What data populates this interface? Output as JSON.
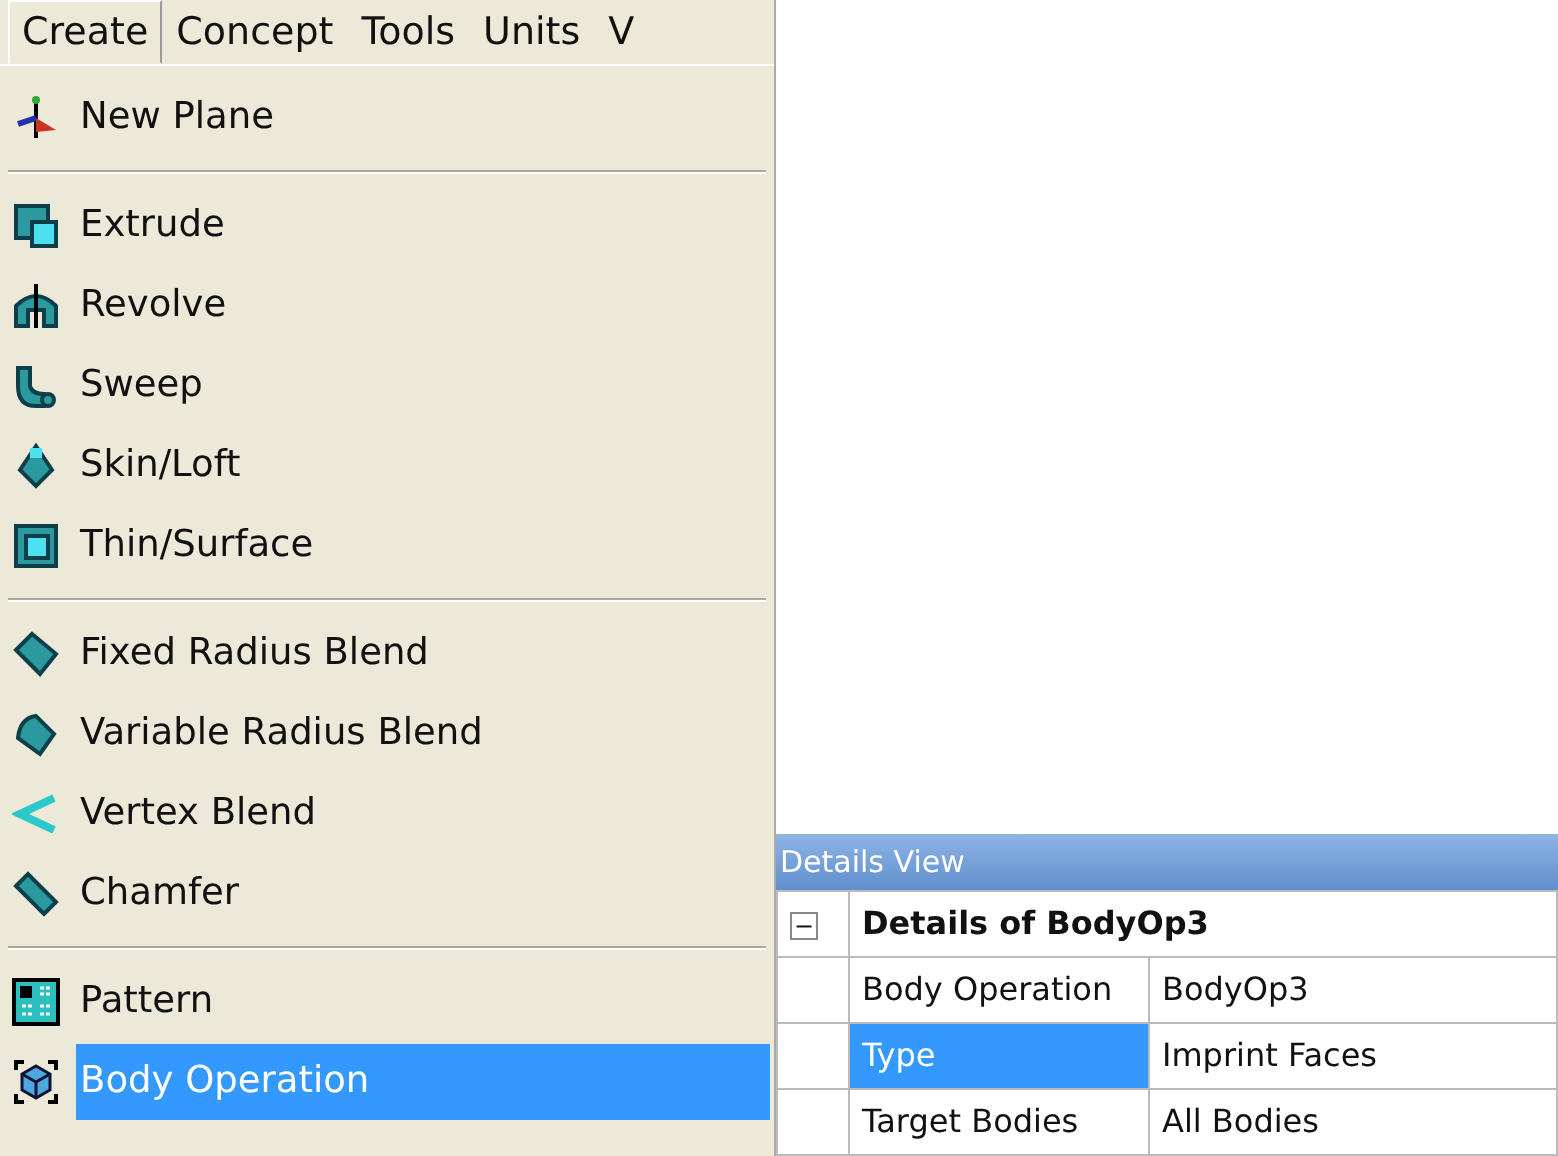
{
  "menu_bar": [
    {
      "label": "Create",
      "selected": true
    },
    {
      "label": "Concept",
      "selected": false
    },
    {
      "label": "Tools",
      "selected": false
    },
    {
      "label": "Units",
      "selected": false
    },
    {
      "label": "V",
      "selected": false
    }
  ],
  "menu_groups": [
    [
      {
        "label": "New Plane",
        "selected": false
      }
    ],
    [
      {
        "label": "Extrude",
        "selected": false
      },
      {
        "label": "Revolve",
        "selected": false
      },
      {
        "label": "Sweep",
        "selected": false
      },
      {
        "label": "Skin/Loft",
        "selected": false
      },
      {
        "label": "Thin/Surface",
        "selected": false
      }
    ],
    [
      {
        "label": "Fixed Radius Blend",
        "selected": false
      },
      {
        "label": "Variable Radius Blend",
        "selected": false
      },
      {
        "label": "Vertex Blend",
        "selected": false
      },
      {
        "label": "Chamfer",
        "selected": false
      }
    ],
    [
      {
        "label": "Pattern",
        "selected": false
      },
      {
        "label": "Body Operation",
        "selected": true
      }
    ]
  ],
  "details_view": {
    "title": "Details View",
    "group": {
      "label": "Details of BodyOp3",
      "expanded": true,
      "toggle": "−"
    },
    "rows": [
      {
        "name": "Body Operation",
        "value": "BodyOp3",
        "selected": false
      },
      {
        "name": "Type",
        "value": "Imprint Faces",
        "selected": true
      },
      {
        "name": "Target Bodies",
        "value": "All Bodies",
        "selected": false
      }
    ]
  }
}
